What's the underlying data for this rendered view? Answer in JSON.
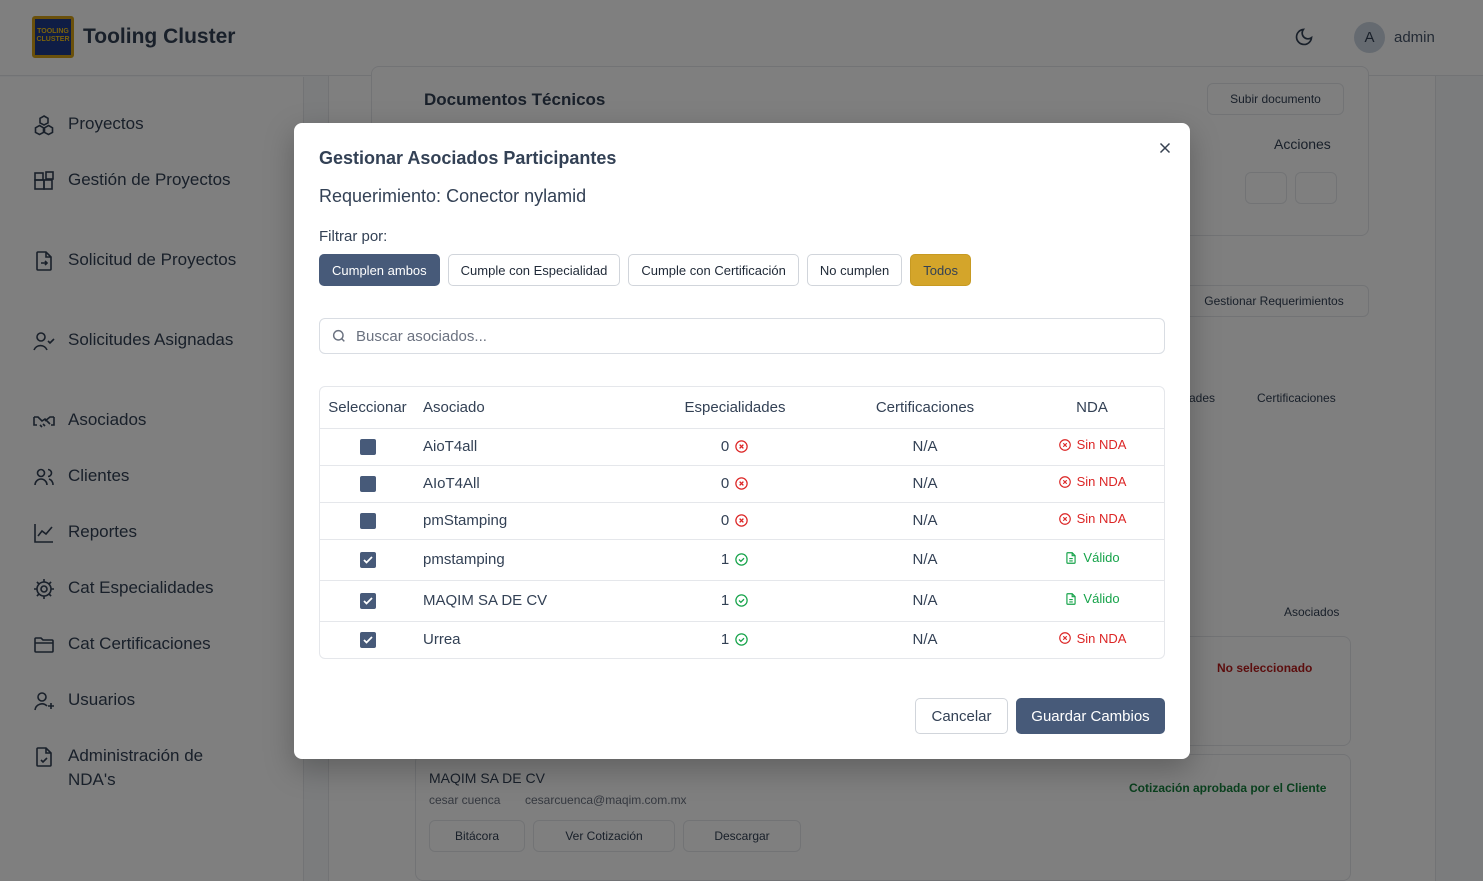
{
  "app": {
    "title": "Tooling Cluster",
    "logo_text": "TOOLING CLUSTER",
    "user_initial": "A",
    "user_name": "admin"
  },
  "sidebar": {
    "items": [
      {
        "label": "Proyectos",
        "icon": "boxes-icon"
      },
      {
        "label": "Gestión de Proyectos",
        "icon": "blocks-icon"
      },
      {
        "label": "Solicitud de Proyectos",
        "icon": "file-import-icon"
      },
      {
        "label": "Solicitudes Asignadas",
        "icon": "user-check-icon"
      },
      {
        "label": "Asociados",
        "icon": "handshake-icon"
      },
      {
        "label": "Clientes",
        "icon": "users-icon"
      },
      {
        "label": "Reportes",
        "icon": "chart-line-icon"
      },
      {
        "label": "Cat Especialidades",
        "icon": "gear-icon"
      },
      {
        "label": "Cat Certificaciones",
        "icon": "folder-icon"
      },
      {
        "label": "Usuarios",
        "icon": "user-plus-icon"
      },
      {
        "label": "Administración de NDA's",
        "icon": "file-check-icon"
      }
    ]
  },
  "background": {
    "docs_title": "Documentos Técnicos",
    "upload_btn": "Subir documento",
    "acciones": "Acciones",
    "manage_req_btn": "Gestionar Requerimientos",
    "ades": "ades",
    "certificaciones": "Certificaciones",
    "asociados": "Asociados",
    "no_seleccionado": "No seleccionado",
    "company": "MAQIM SA DE CV",
    "contact": "cesar cuenca",
    "email": "cesarcuenca@maqim.com.mx",
    "approved": "Cotización aprobada por el Cliente",
    "bitacora": "Bitácora",
    "ver_cotizacion": "Ver Cotización",
    "descargar": "Descargar"
  },
  "modal": {
    "title": "Gestionar Asociados Participantes",
    "subtitle": "Requerimiento: Conector nylamid",
    "filter_label": "Filtrar por:",
    "filters": [
      "Cumplen ambos",
      "Cumple con Especialidad",
      "Cumple con Certificación",
      "No cumplen",
      "Todos"
    ],
    "search_placeholder": "Buscar asociados...",
    "columns": [
      "Seleccionar",
      "Asociado",
      "Especialidades",
      "Certificaciones",
      "NDA"
    ],
    "rows": [
      {
        "name": "AioT4all",
        "checked": false,
        "especialidades": "0",
        "esp_status": "fail",
        "certificaciones": "N/A",
        "nda": "Sin NDA",
        "nda_status": "bad"
      },
      {
        "name": "AIoT4All",
        "checked": false,
        "especialidades": "0",
        "esp_status": "fail",
        "certificaciones": "N/A",
        "nda": "Sin NDA",
        "nda_status": "bad"
      },
      {
        "name": "pmStamping",
        "checked": false,
        "especialidades": "0",
        "esp_status": "fail",
        "certificaciones": "N/A",
        "nda": "Sin NDA",
        "nda_status": "bad"
      },
      {
        "name": "pmstamping",
        "checked": true,
        "especialidades": "1",
        "esp_status": "ok",
        "certificaciones": "N/A",
        "nda": "Válido",
        "nda_status": "good"
      },
      {
        "name": "MAQIM SA DE CV",
        "checked": true,
        "especialidades": "1",
        "esp_status": "ok",
        "certificaciones": "N/A",
        "nda": "Válido",
        "nda_status": "good"
      },
      {
        "name": "Urrea",
        "checked": true,
        "especialidades": "1",
        "esp_status": "ok",
        "certificaciones": "N/A",
        "nda": "Sin NDA",
        "nda_status": "bad"
      }
    ],
    "cancel_label": "Cancelar",
    "save_label": "Guardar Cambios"
  },
  "colors": {
    "primary": "#475a79",
    "gold": "#d4a52a",
    "danger": "#dc2626",
    "success": "#16a34a"
  }
}
